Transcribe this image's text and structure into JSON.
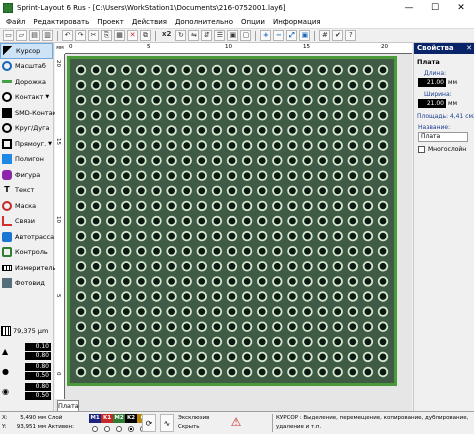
{
  "window": {
    "title": "Sprint-Layout 6 Rus - [C:\\Users\\WorkStation1\\Documents\\216-0752001.lay6]",
    "minimize": "—",
    "maximize": "☐",
    "close": "✕"
  },
  "menu": [
    "Файл",
    "Редактировать",
    "Проект",
    "Действия",
    "Дополнительно",
    "Опции",
    "Информация"
  ],
  "toolbar": {
    "zoom_label": "x2",
    "buttons": [
      "new-icon",
      "open-icon",
      "save-icon",
      "print-icon",
      "undo-icon",
      "redo-icon",
      "cut-icon",
      "copy-icon",
      "paste-icon",
      "delete-icon",
      "duplicate-icon",
      "rotate-icon",
      "mirror-h-icon",
      "mirror-v-icon",
      "align-icon",
      "group-icon",
      "ungroup-icon",
      "zoom-in-icon",
      "zoom-out-icon",
      "zoom-fit-icon",
      "zoom-board-icon",
      "snap-icon",
      "drc-icon",
      "help-icon"
    ]
  },
  "tools": [
    {
      "label": "Курсор",
      "icon": "cursor-icon",
      "selected": true
    },
    {
      "label": "Масштаб",
      "icon": "zoom-icon"
    },
    {
      "label": "Дорожка",
      "icon": "track-icon"
    },
    {
      "label": "Контакт",
      "icon": "pad-icon",
      "dropdown": true
    },
    {
      "label": "SMD-Контакт",
      "icon": "smd-pad-icon"
    },
    {
      "label": "Круг/Дуга",
      "icon": "circle-icon"
    },
    {
      "label": "Прямоуг.",
      "icon": "rectangle-icon",
      "dropdown": true
    },
    {
      "label": "Полигон",
      "icon": "polygon-icon"
    },
    {
      "label": "Фигура",
      "icon": "shape-icon"
    },
    {
      "label": "Текст",
      "icon": "text-icon"
    },
    {
      "label": "Маска",
      "icon": "mask-icon"
    },
    {
      "label": "Связи",
      "icon": "connection-icon"
    },
    {
      "label": "Автотрасса",
      "icon": "autoroute-icon"
    },
    {
      "label": "Контроль",
      "icon": "test-icon"
    },
    {
      "label": "Измеритель",
      "icon": "measure-icon"
    },
    {
      "label": "Фотовид",
      "icon": "photoview-icon"
    }
  ],
  "grid": {
    "value": "79,375 μm"
  },
  "track_widths": {
    "a": "0.10",
    "b": "0.80"
  },
  "pad_sizes": {
    "a": "0.80",
    "b": "0.50"
  },
  "via_sizes": {
    "a": "0.80",
    "b": "0.50"
  },
  "rulers": {
    "unit": "мм",
    "top_ticks": [
      "0",
      "5",
      "10",
      "15",
      "20"
    ],
    "left_ticks": [
      "20",
      "15",
      "10",
      "5",
      "0"
    ]
  },
  "board_tab": "Плата",
  "pad_grid": {
    "rows": 21,
    "cols": 21,
    "missing_note": ""
  },
  "colors": {
    "board": "#3f5b46",
    "board_outline": "#4a9a3c",
    "pad_ring": "#d8e8d0",
    "drill": "#0b1a10",
    "selected_tool": "#cfe3f7"
  },
  "properties": {
    "title": "Свойства",
    "section": "Плата",
    "length_label": "Длина:",
    "length_value": "21.00",
    "width_label": "Ширина:",
    "width_value": "21.00",
    "unit": "мм",
    "area": "Площадь: 4,41 см2",
    "name_label": "Название:",
    "name_value": "Плата",
    "multilayer_label": "Многослойн"
  },
  "status": {
    "x_label": "X:",
    "x_value": "5,490 мм",
    "y_label": "Y:",
    "y_value": "93,951 мм",
    "layer_label": "Слой",
    "active_label": "Активен:",
    "layers": [
      {
        "name": "M1",
        "color": "#1a237e"
      },
      {
        "name": "K1",
        "color": "#c62828"
      },
      {
        "name": "M2",
        "color": "#2e7d32"
      },
      {
        "name": "K2",
        "color": "#000000"
      },
      {
        "name": "O",
        "color": "#b8860b"
      }
    ],
    "active_layer_index": 3,
    "exclude_label": "Эксклюзив",
    "hide_label": "Скрыть",
    "hint": "КУРСОР : Выделение, перемещение, копирование, дублирование, удаление и т.п."
  }
}
